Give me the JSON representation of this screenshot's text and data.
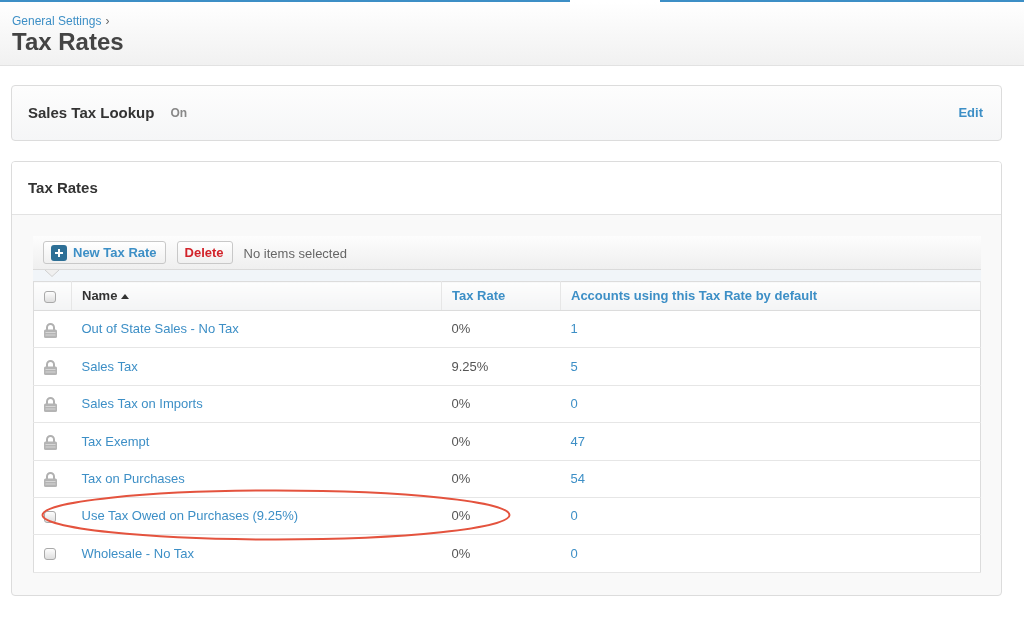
{
  "breadcrumb": {
    "label": "General Settings",
    "separator": "›"
  },
  "page_title": "Tax Rates",
  "sales_tax_lookup": {
    "title": "Sales Tax Lookup",
    "status": "On",
    "action": "Edit"
  },
  "tax_rates_panel": {
    "title": "Tax Rates",
    "toolbar": {
      "buttons": [
        {
          "kind": "add",
          "label": "New Tax Rate"
        },
        {
          "kind": "delete",
          "label": "Delete"
        }
      ],
      "selection_text": "No items selected"
    },
    "table": {
      "select_all": {
        "checked": false
      },
      "columns": [
        {
          "label": "Name",
          "sorted": true
        },
        {
          "label": "Tax Rate",
          "sorted": false
        },
        {
          "label": "Accounts using this Tax Rate by default",
          "sorted": false
        }
      ],
      "rows": [
        {
          "kind": "locked",
          "name": "Out of State Sales - No Tax",
          "tax_rate": "0%",
          "accounts": "1",
          "circled": false
        },
        {
          "kind": "locked",
          "name": "Sales Tax",
          "tax_rate": "9.25%",
          "accounts": "5",
          "circled": false
        },
        {
          "kind": "locked",
          "name": "Sales Tax on Imports",
          "tax_rate": "0%",
          "accounts": "0",
          "circled": false
        },
        {
          "kind": "locked",
          "name": "Tax Exempt",
          "tax_rate": "0%",
          "accounts": "47",
          "circled": false
        },
        {
          "kind": "locked",
          "name": "Tax on Purchases",
          "tax_rate": "0%",
          "accounts": "54",
          "circled": false
        },
        {
          "kind": "selectable",
          "checked": false,
          "name": "Use Tax Owed on Purchases (9.25%)",
          "tax_rate": "0%",
          "accounts": "0",
          "circled": true
        },
        {
          "kind": "selectable",
          "checked": false,
          "name": "Wholesale - No Tax",
          "tax_rate": "0%",
          "accounts": "0",
          "circled": false
        }
      ]
    }
  }
}
